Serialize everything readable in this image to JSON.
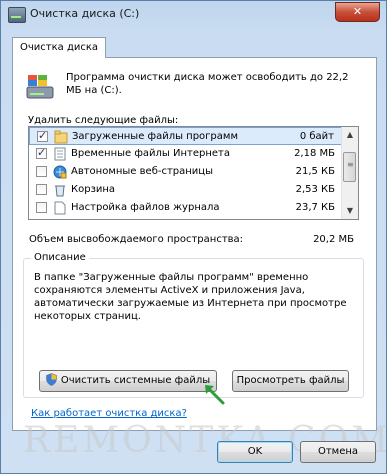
{
  "window": {
    "title": "Очистка диска  (C:)",
    "close_glyph": "✕"
  },
  "tab": {
    "label": "Очистка диска"
  },
  "description": "Программа очистки диска может освободить до 22,2 МБ на  (C:).",
  "files_label": "Удалить следующие файлы:",
  "files": [
    {
      "name": "Загруженные файлы программ",
      "size": "0 байт",
      "checked": true
    },
    {
      "name": "Временные файлы Интернета",
      "size": "2,18 МБ",
      "checked": true
    },
    {
      "name": "Автономные веб-страницы",
      "size": "21,5 КБ",
      "checked": false
    },
    {
      "name": "Корзина",
      "size": "2,53 КБ",
      "checked": false
    },
    {
      "name": "Настройка файлов журнала",
      "size": "23,7 КБ",
      "checked": false
    }
  ],
  "space": {
    "label": "Объем высвобождаемого пространства:",
    "value": "20,2 МБ"
  },
  "details": {
    "title": "Описание",
    "text": "В папке \"Загруженные файлы программ\" временно сохраняются элементы ActiveX и приложения Java, автоматически загружаемые из Интернета при просмотре некоторых страниц."
  },
  "buttons": {
    "clean_system": "Очистить системные файлы",
    "view_files": "Просмотреть файлы",
    "ok": "OK",
    "cancel": "Отмена"
  },
  "help_link": "Как работает очистка диска?",
  "watermark": "REMONTKA.COM",
  "colors": {
    "selection": "#dcebfc",
    "link": "#0066cc",
    "arrow": "#2e9d3a"
  }
}
